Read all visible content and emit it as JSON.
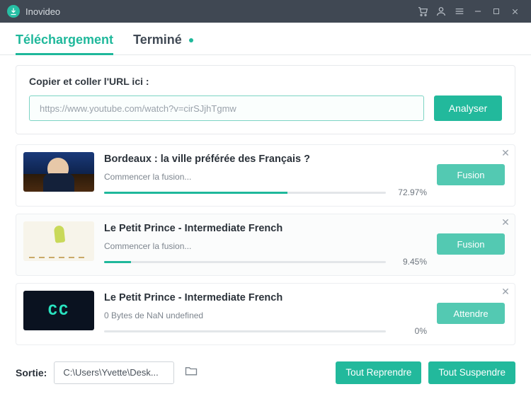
{
  "app": {
    "title": "Inovideo"
  },
  "tabs": {
    "downloading": "Téléchargement",
    "finished": "Terminé"
  },
  "url": {
    "label": "Copier et coller l'URL ici :",
    "value": "https://www.youtube.com/watch?v=cirSJjhTgmw",
    "analyze": "Analyser"
  },
  "downloads": [
    {
      "title": "Bordeaux : la ville préférée des Français ?",
      "status": "Commencer la fusion...",
      "percent": "72.97%",
      "fill": "65%",
      "action": "Fusion",
      "thumb": "bordeaux"
    },
    {
      "title": "Le Petit Prince - Intermediate French",
      "status": "Commencer la fusion...",
      "percent": "9.45%",
      "fill": "9.45%",
      "action": "Fusion",
      "thumb": "prince"
    },
    {
      "title": "Le Petit Prince - Intermediate French",
      "status": "0 Bytes de NaN undefined",
      "percent": "0%",
      "fill": "0%",
      "action": "Attendre",
      "thumb": "cc",
      "cc": "CC"
    }
  ],
  "footer": {
    "label": "Sortie:",
    "path": "C:\\Users\\Yvette\\Desk...",
    "resume_all": "Tout Reprendre",
    "suspend_all": "Tout Suspendre"
  }
}
